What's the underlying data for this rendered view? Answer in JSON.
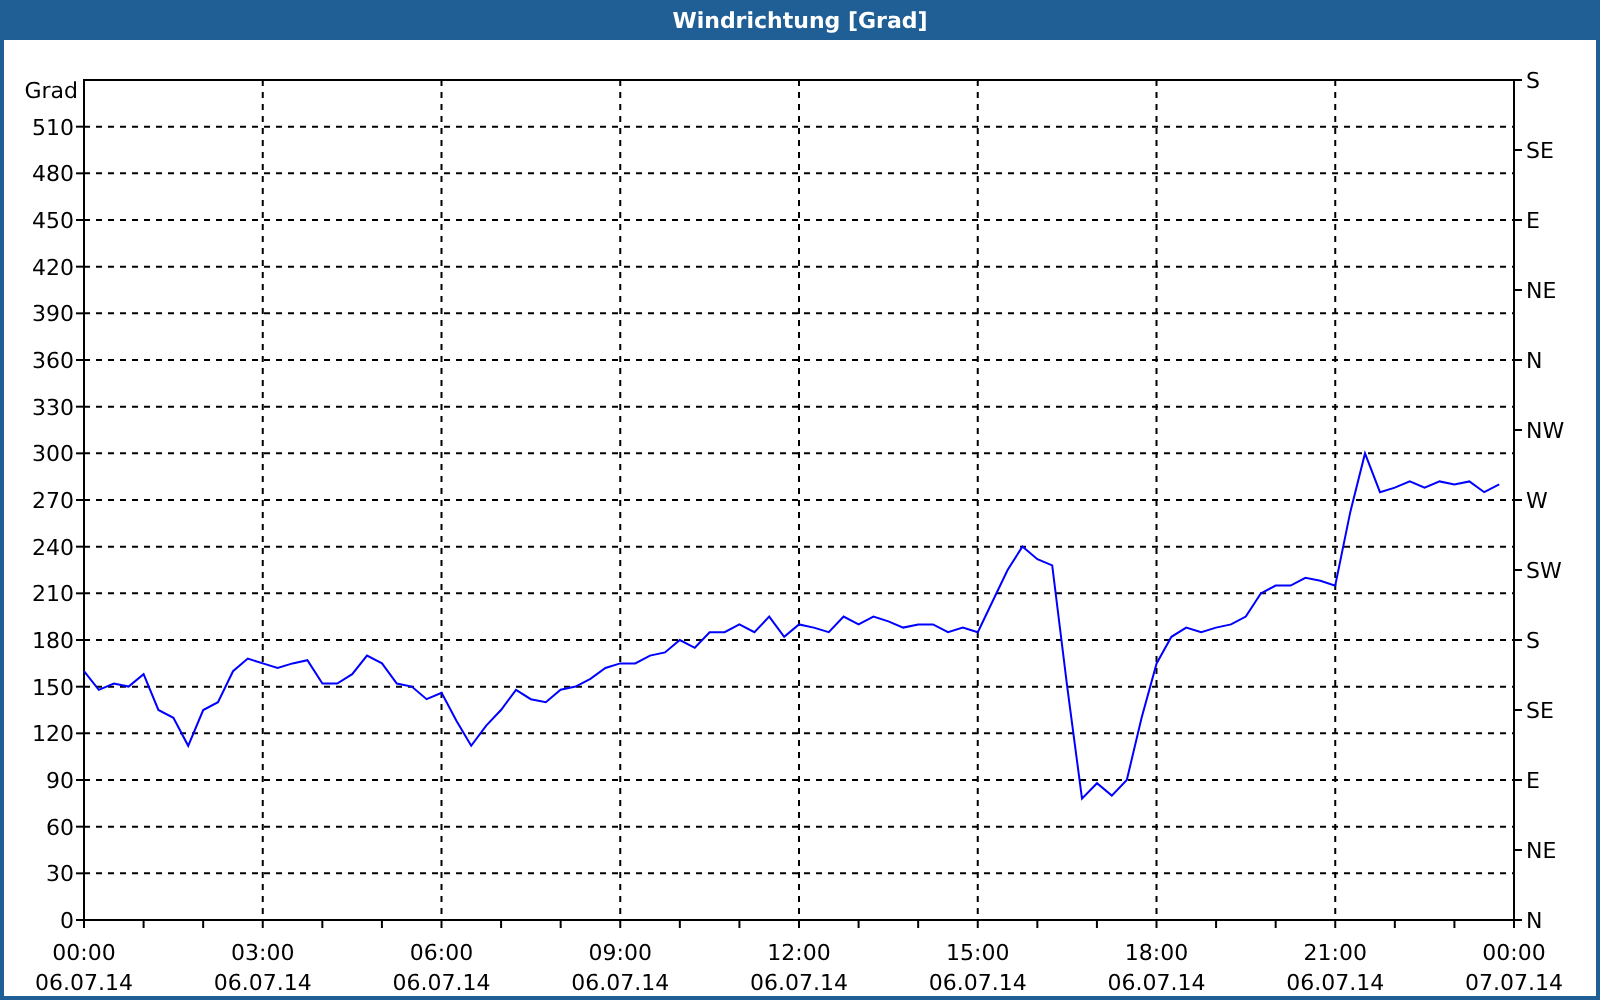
{
  "window": {
    "title": "Windrichtung [Grad]"
  },
  "chart_data": {
    "type": "line",
    "grid": true,
    "ylabel": "Grad",
    "ylim": [
      0,
      540
    ],
    "yticks": [
      0,
      30,
      60,
      90,
      120,
      150,
      180,
      210,
      240,
      270,
      300,
      330,
      360,
      390,
      420,
      450,
      480,
      510
    ],
    "categories": [
      "00:00\n06.07.14",
      null,
      null,
      null,
      null,
      null,
      null,
      null,
      null,
      null,
      null,
      null,
      "03:00\n06.07.14",
      null,
      null,
      null,
      null,
      null,
      null,
      null,
      null,
      null,
      null,
      null,
      "06:00\n06.07.14",
      null,
      null,
      null,
      null,
      null,
      null,
      null,
      null,
      null,
      null,
      null,
      "09:00\n06.07.14",
      null,
      null,
      null,
      null,
      null,
      null,
      null,
      null,
      null,
      null,
      null,
      "12:00\n06.07.14",
      null,
      null,
      null,
      null,
      null,
      null,
      null,
      null,
      null,
      null,
      null,
      "15:00\n06.07.14",
      null,
      null,
      null,
      null,
      null,
      null,
      null,
      null,
      null,
      null,
      null,
      "18:00\n06.07.14",
      null,
      null,
      null,
      null,
      null,
      null,
      null,
      null,
      null,
      null,
      null,
      "21:00\n06.07.14",
      null,
      null,
      null,
      null,
      null,
      null,
      null,
      null,
      null,
      null,
      null,
      "00:00\n07.07.14"
    ],
    "series": [
      {
        "color": "#0000ff",
        "values": [
          160,
          148,
          152,
          150,
          158,
          135,
          130,
          112,
          135,
          140,
          160,
          168,
          165,
          162,
          165,
          167,
          152,
          152,
          158,
          170,
          165,
          152,
          150,
          142,
          146,
          128,
          112,
          125,
          135,
          148,
          142,
          140,
          148,
          150,
          155,
          162,
          165,
          165,
          170,
          172,
          180,
          175,
          185,
          185,
          190,
          185,
          195,
          182,
          190,
          188,
          185,
          195,
          190,
          195,
          192,
          188,
          190,
          190,
          185,
          188,
          185,
          205,
          225,
          240,
          232,
          228,
          150,
          78,
          88,
          80,
          90,
          130,
          165,
          182,
          188,
          185,
          188,
          190,
          195,
          210,
          215,
          215,
          220,
          218,
          215,
          262,
          300,
          275,
          278,
          282,
          278,
          282,
          280,
          282,
          275,
          280,
          null
        ]
      }
    ]
  },
  "right_axis": [
    "S",
    "SE",
    "E",
    "NE",
    "N",
    "NW",
    "W",
    "SW",
    "S",
    "SE",
    "E",
    "NE",
    "N"
  ]
}
